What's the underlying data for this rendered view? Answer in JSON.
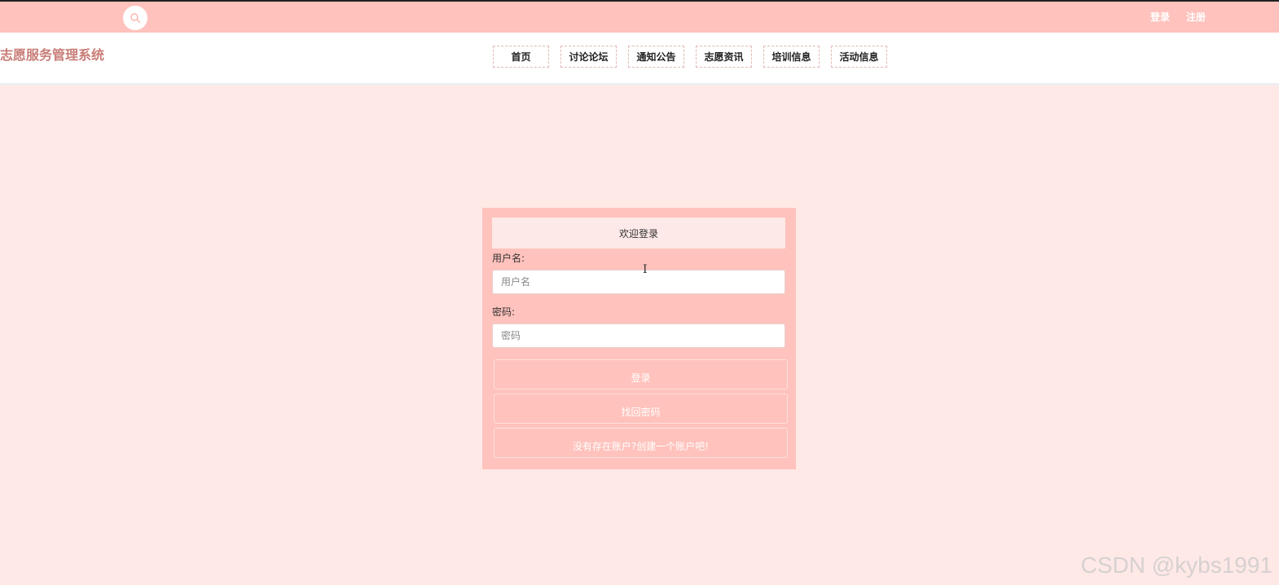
{
  "topbar": {
    "search_icon": "search-icon",
    "links": [
      "登录",
      "注册"
    ]
  },
  "header": {
    "site_title": "志愿服务管理系统",
    "nav": [
      "首页",
      "讨论论坛",
      "通知公告",
      "志愿资讯",
      "培训信息",
      "活动信息"
    ]
  },
  "login": {
    "title": "欢迎登录",
    "username_label": "用户名:",
    "username_placeholder": "用户名",
    "password_label": "密码:",
    "password_placeholder": "密码",
    "login_button": "登录",
    "forgot_button": "找回密码",
    "register_button": "没有存在账户?创建一个账户吧!"
  },
  "watermark": "CSDN @kybs1991",
  "colors": {
    "topbar": "#ffc2bc",
    "page_bg": "#ffe9e7",
    "title_accent": "#c97d77"
  }
}
